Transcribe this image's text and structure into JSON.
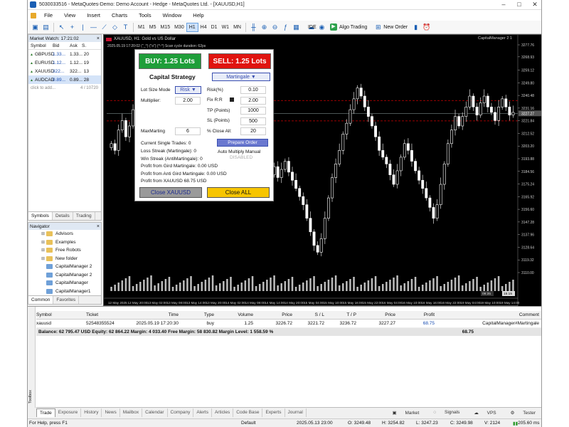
{
  "window": {
    "title": "5030033516 - MetaQuotes-Demo: Demo Account - Hedge - MetaQuotes Ltd. - [XAUUSD,H1]"
  },
  "menu": [
    "File",
    "View",
    "Insert",
    "Charts",
    "Tools",
    "Window",
    "Help"
  ],
  "toolbar": {
    "timeframes": [
      "M1",
      "M5",
      "M15",
      "M30",
      "H1",
      "H4",
      "D1",
      "W1",
      "MN"
    ],
    "active_tf": "H1",
    "ide": "IDE",
    "algo": "Algo Trading",
    "new_order": "New Order"
  },
  "market_watch": {
    "title": "Market Watch: 17:21:02",
    "headers": [
      "Symbol",
      "Bid",
      "Ask",
      "S."
    ],
    "rows": [
      {
        "s": "GBPUSD",
        "b": "1.33...",
        "a": "1.33...",
        "sp": "20"
      },
      {
        "s": "EURUSD",
        "b": "1.12...",
        "a": "1.12...",
        "sp": "19"
      },
      {
        "s": "XAUUSD",
        "b": "322...",
        "a": "322...",
        "sp": "13"
      },
      {
        "s": "AUDCAD",
        "b": "0.89...",
        "a": "0.89...",
        "sp": "28"
      }
    ],
    "add": "click to add...",
    "count": "4 / 10720",
    "tabs": [
      "Symbols",
      "Details",
      "Trading"
    ]
  },
  "navigator": {
    "title": "Navigator",
    "items": [
      "Advisors",
      "Examples",
      "Free Robots",
      "New folder",
      "CapitalManager 2",
      "CapitalManager 2",
      "CapitalManager",
      "CapitalManager1"
    ],
    "tabs": [
      "Common",
      "Favorites"
    ]
  },
  "chart": {
    "symbol_line": "XAUUSD, H1:  Gold vs US Dollar",
    "tag": "CapitalManager 2 1",
    "sub": "2025.05.19 17:20:02 (\"_^) (\"o\") (^-^)  Scan cycle duration: 62ps",
    "price_labels": [
      "3277.76",
      "3268.93",
      "3259.12",
      "3249.80",
      "3240.48",
      "3231.16",
      "3221.84",
      "3212.52",
      "3203.20",
      "3193.88",
      "3184.56",
      "3175.24",
      "3165.92",
      "3156.60",
      "3147.28",
      "3137.96",
      "3128.64",
      "3119.32",
      "3110.00"
    ],
    "current_price": "3227.27",
    "dates": [
      "12 May 2025",
      "12 May 20:00",
      "13 May 02:00",
      "13 May 08:00",
      "13 May 14:00",
      "13 May 20:00",
      "14 May 02:00",
      "14 May 08:00",
      "14 May 14:00",
      "14 May 20:00",
      "15 May 04:00",
      "15 May 10:00",
      "15 May 16:00",
      "15 May 22:00",
      "16 May 04:00",
      "16 May 10:00",
      "16 May 16:00",
      "16 May 22:00",
      "19 May 04:00",
      "19 May 10:00",
      "19 May 14:00"
    ],
    "markers": [
      "09:35",
      "15:15"
    ]
  },
  "panel": {
    "buy": "BUY: 1.25 Lots",
    "sell": "SELL: 1.25 Lots",
    "strategy_title": "Capital Strategy",
    "strategy": "Martingale",
    "lot_size_mode": "Lot Size Mode",
    "lot_mode_val": "Risk",
    "multiplier": "Multiplier:",
    "multiplier_val": "2.00",
    "risk": "Risk(%)",
    "risk_val": "0.10",
    "fixrr": "Fix R:R",
    "fixrr_val": "2.00",
    "tp": "TP (Points)",
    "tp_val": "1000",
    "sl": "SL (Points)",
    "sl_val": "500",
    "closeall_pct": "% Close All:",
    "closeall_val": "20",
    "maxmarting": "MaxMarting",
    "maxmarting_val": "6",
    "prepare": "Prepare Order",
    "auto": "Auto Multiply Manual",
    "disabled": "DISABLED",
    "info": [
      "Current Single Trades: 0",
      "Loss Streak (Martingale): 0",
      "Win Streak (AntiMartingale): 0",
      "Profit from Gird Martingale: 0.00 USD",
      "Profit from Anti Gird Martingale: 0.00 USD",
      "Profit from XAUUSD 68.75 USD"
    ],
    "close_sym": "Close XAUUSD",
    "close_all": "Close ALL"
  },
  "trade": {
    "headers": [
      "Symbol",
      "Ticket",
      "Time",
      "Type",
      "Volume",
      "Price",
      "S / L",
      "T / P",
      "Price",
      "Profit",
      "Comment"
    ],
    "row": [
      "xauusd",
      "52548355524",
      "2025.05.19 17:20:30",
      "buy",
      "1.25",
      "3226.72",
      "3221.72",
      "3236.72",
      "3227.27",
      "68.75",
      "CapitalManager#Martingale"
    ],
    "balance": "Balance: 62 795.47 USD  Equity: 62 864.22  Margin: 4 033.40  Free Margin: 58 830.82  Margin Level: 1 558.59 %",
    "balance_profit": "68.75",
    "tabs": [
      "Trade",
      "Exposure",
      "History",
      "News",
      "Mailbox",
      "Calendar",
      "Company",
      "Alerts",
      "Articles",
      "Code Base",
      "Experts",
      "Journal"
    ],
    "right": [
      "Market",
      "Signals",
      "VPS",
      "Tester"
    ],
    "toolbox": "Toolbox"
  },
  "status": {
    "help": "For Help, press F1",
    "profile": "Default",
    "time": "2025.05.13 23:00",
    "o": "O: 3249.48",
    "h": "H: 3254.82",
    "l": "L: 3247.23",
    "c": "C: 3249.98",
    "v": "V: 2124",
    "conn": "205.60 ms"
  },
  "chart_data": {
    "type": "candlestick",
    "ylim": [
      3110.0,
      3277.76
    ],
    "candles": [
      3205,
      3200,
      3215,
      3222,
      3210,
      3218,
      3230,
      3224,
      3215,
      3222,
      3228,
      3222,
      3215,
      3224,
      3232,
      3226,
      3238,
      3230,
      3225,
      3234,
      3226,
      3220,
      3228,
      3222,
      3216,
      3222,
      3226,
      3220,
      3226,
      3234,
      3228,
      3232,
      3226,
      3220,
      3210,
      3200,
      3190,
      3186,
      3180,
      3190,
      3185,
      3178,
      3170,
      3176,
      3182,
      3188,
      3180,
      3186,
      3192,
      3184,
      3178,
      3172,
      3166,
      3160,
      3150,
      3140,
      3130,
      3125,
      3135,
      3150,
      3165,
      3180,
      3190,
      3200,
      3212,
      3220,
      3230,
      3238,
      3246,
      3240,
      3232,
      3225,
      3218,
      3210,
      3200,
      3195,
      3190,
      3182,
      3175,
      3185,
      3195,
      3205,
      3200,
      3192,
      3185,
      3178,
      3172,
      3165,
      3158,
      3150,
      3160,
      3175,
      3190,
      3205,
      3215,
      3225,
      3218,
      3225,
      3232,
      3240,
      3232,
      3226,
      3235,
      3240,
      3232,
      3228,
      3222,
      3232,
      3238,
      3232,
      3226,
      3228
    ]
  }
}
